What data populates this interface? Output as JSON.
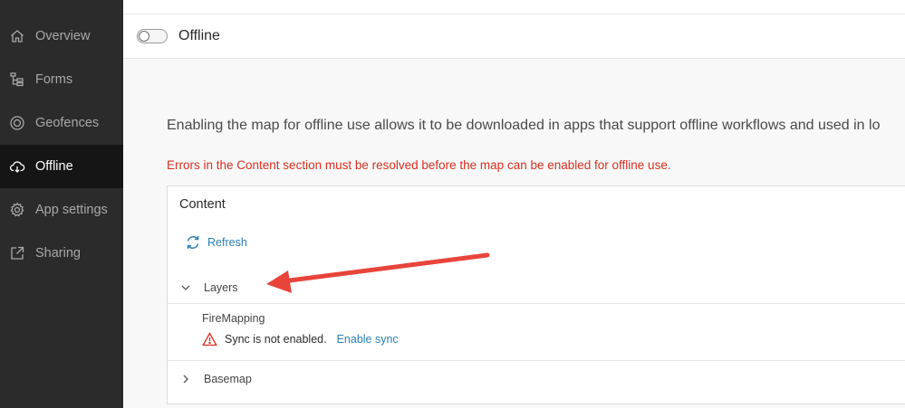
{
  "sidebar": {
    "items": [
      {
        "label": "Overview",
        "icon": "home-icon"
      },
      {
        "label": "Forms",
        "icon": "forms-tree-icon"
      },
      {
        "label": "Geofences",
        "icon": "geofence-target-icon"
      },
      {
        "label": "Offline",
        "icon": "offline-cloud-icon",
        "active": true
      },
      {
        "label": "App settings",
        "icon": "gear-icon"
      },
      {
        "label": "Sharing",
        "icon": "share-icon"
      }
    ]
  },
  "offline": {
    "toggle_label": "Offline",
    "enabled": false
  },
  "main": {
    "description": "Enabling the map for offline use allows it to be downloaded in apps that support offline workflows and used in lo",
    "error": "Errors in the Content section must be resolved before the map can be enabled for offline use."
  },
  "content": {
    "title": "Content",
    "refresh_label": "Refresh",
    "layers_label": "Layers",
    "layer_name": "FireMapping",
    "warning_text": "Sync is not enabled.",
    "enable_sync_label": "Enable sync",
    "basemap_label": "Basemap"
  },
  "colors": {
    "sidebar_bg": "#2b2b2b",
    "sidebar_active_bg": "#151515",
    "link": "#2a7fb5",
    "error": "#d83020",
    "annotation_arrow": "#e8443a"
  }
}
